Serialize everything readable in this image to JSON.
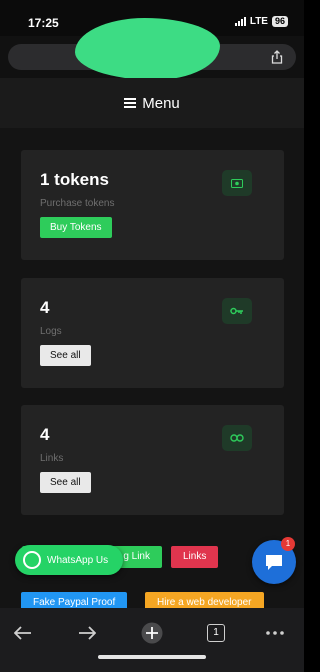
{
  "status_bar": {
    "time": "17:25",
    "network": "LTE",
    "battery": "96"
  },
  "navbar": {
    "menu_label": "Menu"
  },
  "cards": [
    {
      "title": "1 tokens",
      "subtitle": "Purchase tokens",
      "button": "Buy Tokens",
      "icon": "money-icon"
    },
    {
      "title": "4",
      "subtitle": "Logs",
      "button": "See all",
      "icon": "key-icon"
    },
    {
      "title": "4",
      "subtitle": "Links",
      "button": "See all",
      "icon": "link-icon"
    }
  ],
  "buttons": {
    "create_link": "g Link",
    "links": "Links",
    "fake_paypal": "Fake Paypal Proof",
    "hire_dev": "Hire a web developer"
  },
  "whatsapp": {
    "label": "WhatsApp Us"
  },
  "chat": {
    "badge": "1"
  },
  "toolbar": {
    "tabs_count": "1"
  },
  "colors": {
    "green": "#2ecc5b",
    "red": "#e0354e",
    "blue": "#2196f3",
    "orange": "#f5a623",
    "card_bg": "#232323",
    "page_bg": "#141414"
  }
}
